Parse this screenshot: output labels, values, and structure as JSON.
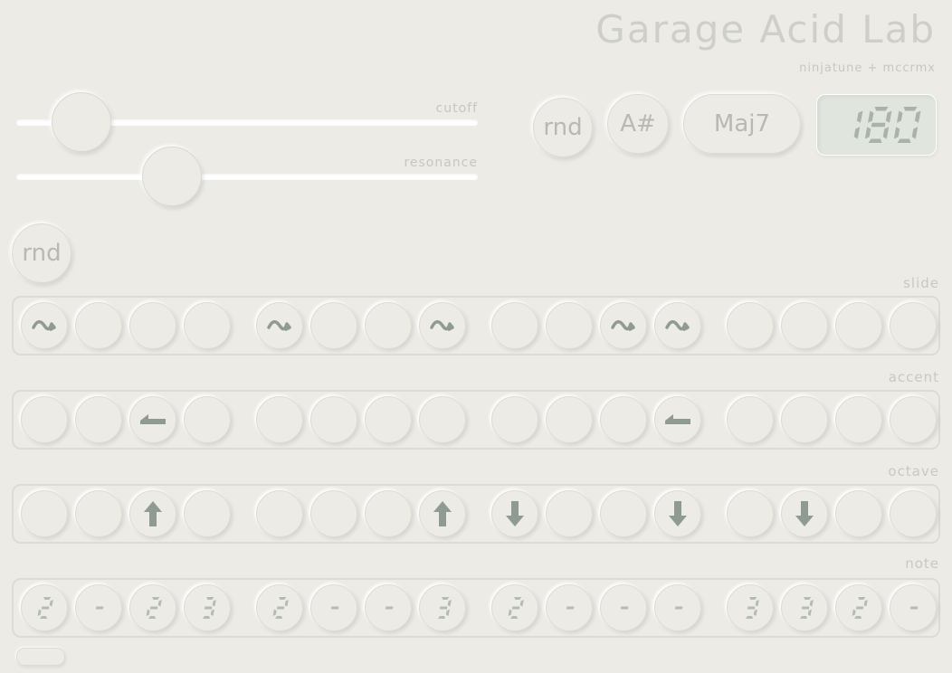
{
  "header": {
    "title": "Garage Acid Lab",
    "subtitle": "ninjatune + mccrmx"
  },
  "sliders": [
    {
      "id": "cutoff",
      "label": "cutoff",
      "value": 0.14
    },
    {
      "id": "resonance",
      "label": "resonance",
      "value": 0.335
    }
  ],
  "controls": {
    "random_label": "rnd",
    "key_label": "A#",
    "chord_label": "Maj7",
    "bpm": "180",
    "pattern_random_label": "rnd"
  },
  "sections": {
    "slide": {
      "label": "slide",
      "steps": [
        1,
        0,
        0,
        0,
        1,
        0,
        0,
        1,
        0,
        0,
        1,
        1,
        0,
        0,
        0,
        0
      ]
    },
    "accent": {
      "label": "accent",
      "steps": [
        0,
        0,
        1,
        0,
        0,
        0,
        0,
        0,
        0,
        0,
        0,
        1,
        0,
        0,
        0,
        0
      ]
    },
    "octave": {
      "label": "octave",
      "steps": [
        "",
        "",
        "up",
        "",
        "",
        "",
        "",
        "up",
        "down",
        "",
        "",
        "down",
        "",
        "down",
        "",
        ""
      ]
    },
    "note": {
      "label": "note",
      "steps": [
        "2",
        "-",
        "2",
        "3",
        "2",
        "-",
        "-",
        "3",
        "2",
        "-",
        "-",
        "-",
        "3",
        "3",
        "2",
        "-"
      ]
    }
  },
  "colors": {
    "background": "#ecebe6",
    "icon": "#8f9a92",
    "text_faint": "#c9c9c3",
    "display_bg": "#e0e5de"
  },
  "icons": {
    "slide": "slide-wave-icon",
    "accent": "accent-step-icon",
    "octave_up": "arrow-up-icon",
    "octave_down": "arrow-down-icon"
  }
}
